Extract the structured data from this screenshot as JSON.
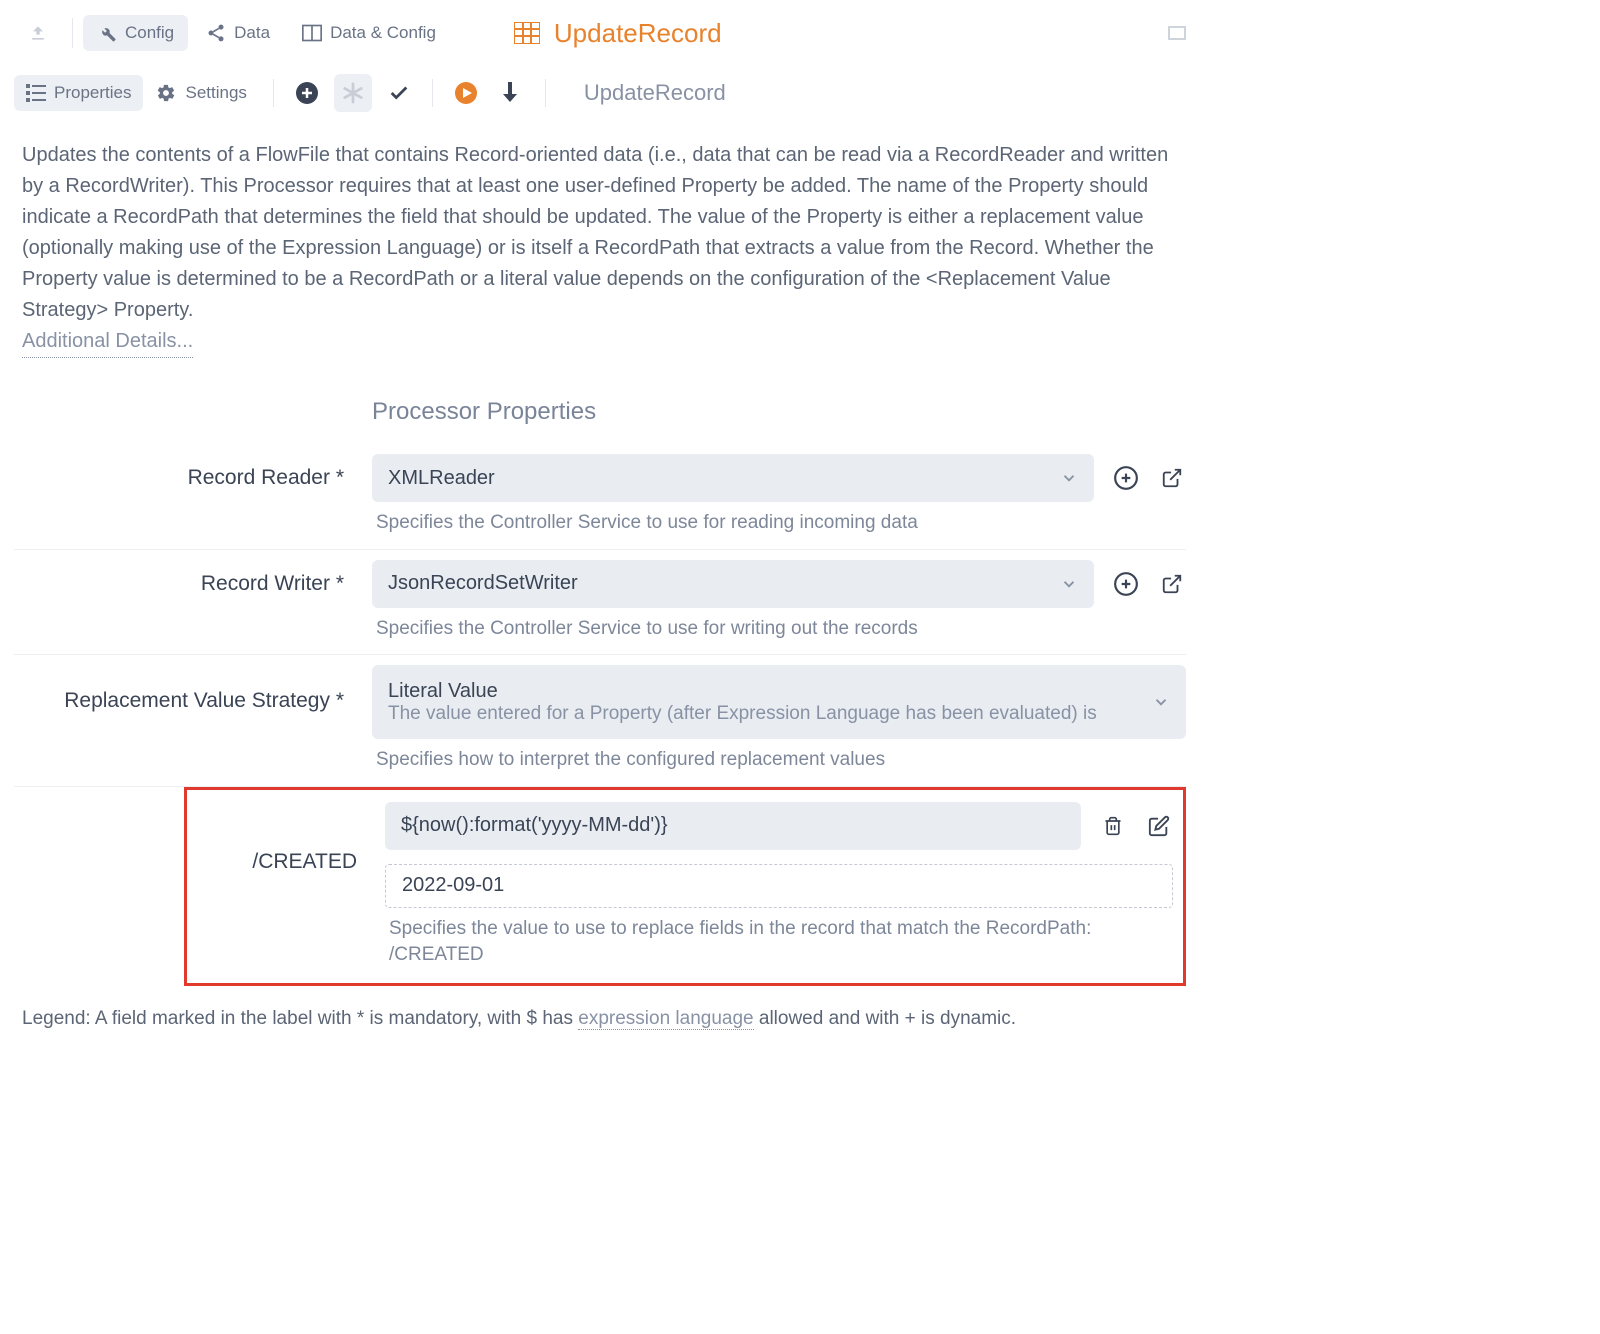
{
  "topTabs": {
    "config": "Config",
    "data": "Data",
    "dataConfig": "Data & Config"
  },
  "processor": {
    "name": "UpdateRecord",
    "breadcrumb": "UpdateRecord"
  },
  "subTabs": {
    "properties": "Properties",
    "settings": "Settings"
  },
  "description": "Updates the contents of a FlowFile that contains Record-oriented data (i.e., data that can be read via a RecordReader and written by a RecordWriter). This Processor requires that at least one user-defined Property be added. The name of the Property should indicate a RecordPath that determines the field that should be updated. The value of the Property is either a replacement value (optionally making use of the Expression Language) or is itself a RecordPath that extracts a value from the Record. Whether the Property value is determined to be a RecordPath or a literal value depends on the configuration of the <Replacement Value Strategy> Property.",
  "additionalDetails": "Additional Details...",
  "sectionTitle": "Processor Properties",
  "props": {
    "recordReader": {
      "label": "Record Reader *",
      "value": "XMLReader",
      "help": "Specifies the Controller Service to use for reading incoming data"
    },
    "recordWriter": {
      "label": "Record Writer *",
      "value": "JsonRecordSetWriter",
      "help": "Specifies the Controller Service to use for writing out the records"
    },
    "replacementStrategy": {
      "label": "Replacement Value Strategy *",
      "value": "Literal Value",
      "sub": "The value entered for a Property (after Expression Language has been evaluated) is",
      "help": "Specifies how to interpret the configured replacement values"
    },
    "created": {
      "label": "/CREATED",
      "value": "${now():format('yyyy-MM-dd')}",
      "preview": "2022-09-01",
      "help": "Specifies the value to use to replace fields in the record that match the RecordPath: /CREATED"
    }
  },
  "legend": {
    "pre": "Legend: A field marked in the label with * is mandatory, with $ has ",
    "link": "expression language",
    "post": " allowed and with + is dynamic."
  }
}
